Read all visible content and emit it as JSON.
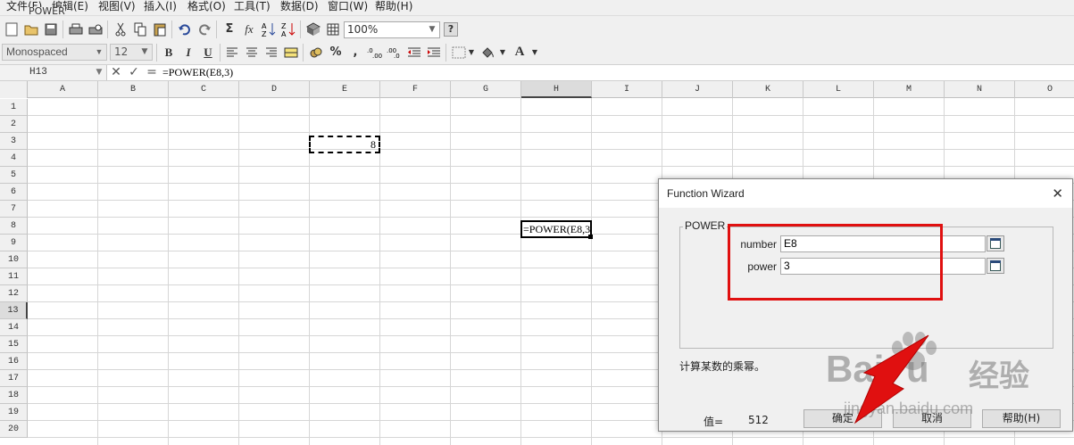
{
  "menubar": {
    "items": [
      "文件(F)",
      "编辑(E)",
      "视图(V)",
      "插入(I)",
      "格式(O)",
      "工具(T)",
      "数据(D)",
      "窗口(W)",
      "帮助(H)"
    ],
    "faint_label": "POWER"
  },
  "toolbar": {
    "zoom_value": "100%",
    "help_icon_label": "?",
    "font_name": "Monospaced",
    "font_size": "12",
    "bold_label": "B",
    "italic_label": "I",
    "underline_label": "U",
    "percent_label": "%",
    "comma_label": ",",
    "font_color_label": "A",
    "sum_label": "Σ",
    "fx_label": "fx"
  },
  "formula_bar": {
    "cell_ref": "H13",
    "formula": "=POWER(E8,3)"
  },
  "sheet": {
    "columns": [
      "A",
      "B",
      "C",
      "D",
      "E",
      "F",
      "G",
      "H",
      "I",
      "J",
      "K",
      "L",
      "M",
      "N",
      "O"
    ],
    "rows": [
      "1",
      "2",
      "3",
      "4",
      "5",
      "6",
      "7",
      "8",
      "9",
      "10",
      "11",
      "12",
      "13",
      "14",
      "15",
      "16",
      "17",
      "18",
      "19",
      "20"
    ],
    "active_column": "H",
    "active_row": "13",
    "e8_value": "8",
    "h13_value": "=POWER(E8,3)"
  },
  "dialog": {
    "title": "Function Wizard",
    "close_label": "✕",
    "group_label": "POWER",
    "params": [
      {
        "label": "number",
        "value": "E8"
      },
      {
        "label": "power",
        "value": "3"
      }
    ],
    "description": "计算某数的乘幂。",
    "value_label": "值=",
    "value": "512",
    "ok_label": "确定",
    "cancel_label": "取消",
    "help_label": "帮助(H)"
  },
  "watermark": {
    "brand": "Bai",
    "brand_tail": "u",
    "cn": "经验",
    "url": "jingyan.baidu.com"
  },
  "colors": {
    "highlight_red": "#e01010",
    "ui_gray": "#f0f0f0"
  }
}
